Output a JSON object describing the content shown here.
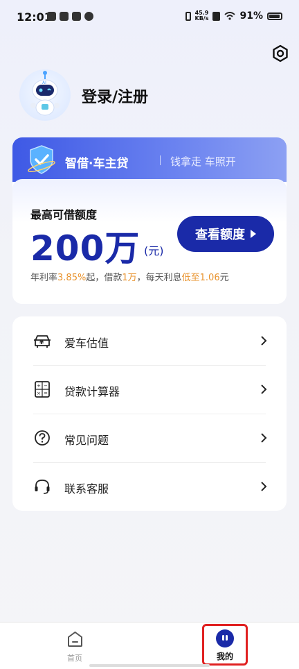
{
  "status_bar": {
    "time": "12:01",
    "net_speed_value": "45.9",
    "net_speed_unit": "KB/s",
    "battery": "91%"
  },
  "profile": {
    "login_label": "登录/注册"
  },
  "loan_card": {
    "brand": "智借·车主贷",
    "slogan": "钱拿走 车照开",
    "limit_label": "最高可借额度",
    "limit_amount": "200万",
    "limit_unit": "(元)",
    "view_button": "查看额度",
    "rate_prefix": "年利率",
    "rate_value": "3.85%",
    "rate_mid": "起，借款",
    "loan_amount": "1万",
    "rate_mid2": "，每天利息",
    "daily_interest": "低至1.06",
    "rate_suffix": "元",
    "accent_color": "#1a2aa8",
    "highlight_color": "#e8912a"
  },
  "menu": {
    "items": [
      {
        "label": "爱车估值",
        "icon": "car-value-icon"
      },
      {
        "label": "贷款计算器",
        "icon": "calculator-icon"
      },
      {
        "label": "常见问题",
        "icon": "question-icon"
      },
      {
        "label": "联系客服",
        "icon": "headset-icon"
      }
    ]
  },
  "tab_bar": {
    "home_label": "首页",
    "mine_label": "我的",
    "active_tab": "我的"
  }
}
